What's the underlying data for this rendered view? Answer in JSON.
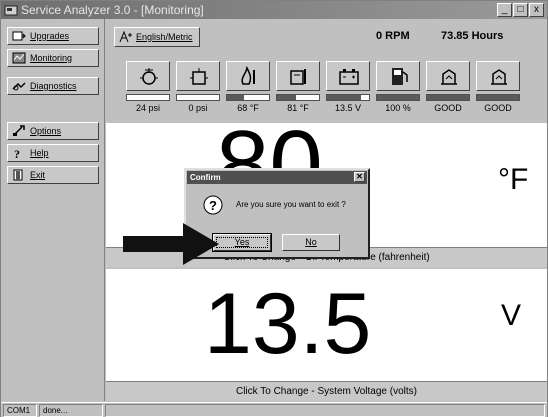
{
  "window": {
    "title": "Service Analyzer 3.0 - [Monitoring]",
    "controls": [
      "_",
      "□",
      "x"
    ]
  },
  "sidebar": {
    "items": [
      {
        "label": "Upgrades",
        "icon": "upgrades-icon"
      },
      {
        "label": "Monitoring",
        "icon": "monitoring-icon"
      },
      {
        "label": "Diagnostics",
        "icon": "diagnostics-icon"
      },
      {
        "label": "Options",
        "icon": "options-icon"
      },
      {
        "label": "Help",
        "icon": "help-icon"
      },
      {
        "label": "Exit",
        "icon": "exit-icon"
      }
    ]
  },
  "toolbar": {
    "english_metric_label": "English/Metric",
    "rpm": "0 RPM",
    "hours": "73.85 Hours"
  },
  "gauges": [
    {
      "name": "oil-pressure",
      "icon": "oil-pressure-icon",
      "value": "24 psi",
      "level": 0.0
    },
    {
      "name": "fuel-pressure",
      "icon": "fuel-pressure-icon",
      "value": "0 psi",
      "level": 0.0
    },
    {
      "name": "oil-temperature",
      "icon": "oil-temperature-icon",
      "value": "68 °F",
      "level": 0.4
    },
    {
      "name": "coolant-temperature",
      "icon": "coolant-temperature-icon",
      "value": "81 °F",
      "level": 0.45
    },
    {
      "name": "battery-voltage",
      "icon": "battery-icon",
      "value": "13.5 V",
      "level": 0.8
    },
    {
      "name": "fuel-level",
      "icon": "fuel-pump-icon",
      "value": "100 %",
      "level": 1.0
    },
    {
      "name": "status-1",
      "icon": "status-icon",
      "value": "GOOD",
      "level": 1.0
    },
    {
      "name": "status-2",
      "icon": "status-icon",
      "value": "GOOD",
      "level": 1.0
    }
  ],
  "panels": {
    "temperature": {
      "value": "80",
      "unit": "°F",
      "caption": "Click To Change - Oil Temperature (fahrenheit)"
    },
    "voltage": {
      "value": "13.5",
      "unit": "V",
      "caption": "Click To Change - System Voltage (volts)"
    }
  },
  "dialog": {
    "title": "Confirm",
    "message": "Are you sure you want to exit ?",
    "yes_label": "Yes",
    "no_label": "No"
  },
  "statusbar": {
    "port": "COM1",
    "status": "done..."
  }
}
